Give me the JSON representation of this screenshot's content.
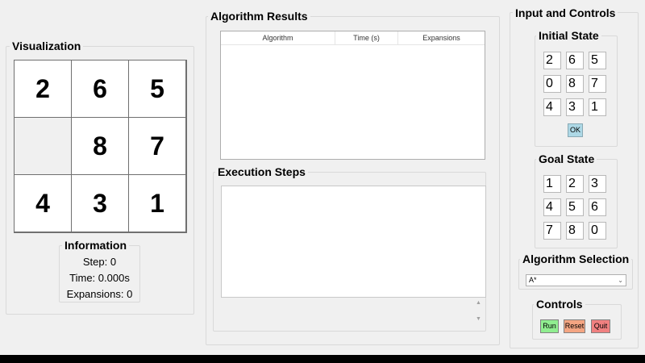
{
  "visualization": {
    "title": "Visualization",
    "tiles": [
      "2",
      "6",
      "5",
      "",
      "8",
      "7",
      "4",
      "3",
      "1"
    ]
  },
  "information": {
    "title": "Information",
    "step": "Step: 0",
    "time": "Time: 0.000s",
    "expansions": "Expansions: 0"
  },
  "results": {
    "title": "Algorithm Results",
    "columns": [
      "Algorithm",
      "Time (s)",
      "Expansions"
    ]
  },
  "steps": {
    "title": "Execution Steps"
  },
  "controls": {
    "title": "Input and Controls",
    "initial": {
      "title": "Initial State",
      "cells": [
        "2",
        "6",
        "5",
        "0",
        "8",
        "7",
        "4",
        "3",
        "1"
      ],
      "ok_label": "OK"
    },
    "goal": {
      "title": "Goal State",
      "cells": [
        "1",
        "2",
        "3",
        "4",
        "5",
        "6",
        "7",
        "8",
        "0"
      ]
    },
    "algorithm": {
      "title": "Algorithm Selection",
      "selected": "A*"
    },
    "buttons": {
      "title": "Controls",
      "run": "Run",
      "reset": "Reset",
      "quit": "Quit"
    }
  },
  "colors": {
    "ok_button": "#add8e6",
    "run_button": "#90ee90",
    "reset_button": "#f4a582",
    "quit_button": "#f08080"
  },
  "icons": {
    "dropdown": "chevron-down-icon",
    "scroll_up": "scroll-up-icon",
    "scroll_down": "scroll-down-icon"
  }
}
